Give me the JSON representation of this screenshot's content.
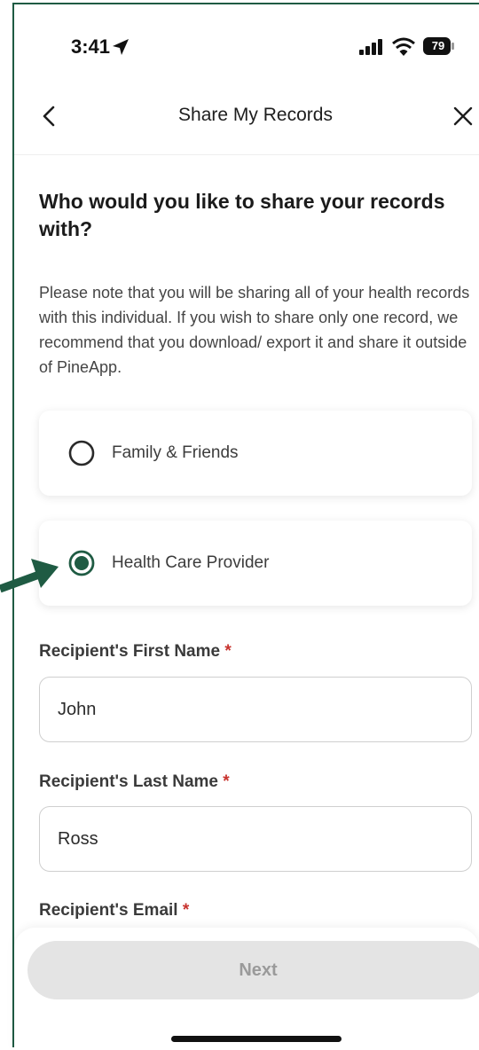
{
  "status_bar": {
    "time": "3:41",
    "battery": "79"
  },
  "header": {
    "title": "Share My Records"
  },
  "question": "Who would you like to share your records with?",
  "note": "Please note that you will be sharing all of your health records with this individual. If you wish to share only one record, we recommend that you download/ export it and share it outside of PineApp.",
  "options": [
    {
      "label": "Family & Friends",
      "selected": false
    },
    {
      "label": "Health Care Provider",
      "selected": true
    }
  ],
  "fields": {
    "first_name": {
      "label": "Recipient's First Name",
      "required": "*",
      "value": "John"
    },
    "last_name": {
      "label": "Recipient's Last Name",
      "required": "*",
      "value": "Ross"
    },
    "email": {
      "label": "Recipient's Email",
      "required": "*"
    }
  },
  "next_label": "Next",
  "colors": {
    "accent": "#1f5b43",
    "required": "#c8332e",
    "button_disabled": "#e4e4e4"
  }
}
